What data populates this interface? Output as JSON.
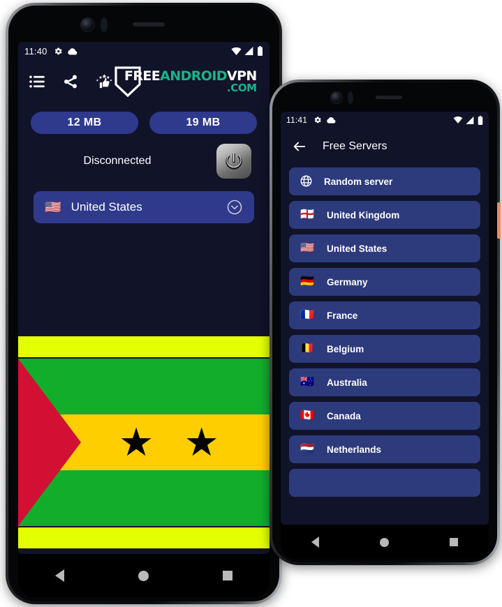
{
  "phone1": {
    "status_bar": {
      "time": "11:40",
      "left_icons": [
        "settings-gear-icon",
        "cloud-icon"
      ],
      "right_icons": [
        "wifi-icon",
        "signal-icon",
        "battery-icon"
      ]
    },
    "toolbar": {
      "icons": [
        "list-menu-icon",
        "share-icon",
        "rate-thumbs-up-icon"
      ],
      "brand": {
        "part1": "FREE",
        "part2": "ANDROID",
        "part3": "VPN",
        "part4": ".COM",
        "color_white": "#ffffff",
        "color_teal": "#18b48a"
      }
    },
    "usage": {
      "download_label": "12 MB",
      "upload_label": "19 MB"
    },
    "connection": {
      "status_text": "Disconnected",
      "power_button_label": "power-toggle"
    },
    "country_selector": {
      "flag": "🇺🇸",
      "name": "United States",
      "chevron": "chevron-down-circle-icon"
    },
    "flag_banner": {
      "name": "Sao Tome and Principe",
      "band_color": "#e4ff00",
      "green": "#12ad2b",
      "yellow": "#ffce00",
      "red": "#d21034",
      "star": "★"
    },
    "nav_bar": [
      "back-nav-button",
      "home-nav-button",
      "recents-nav-button"
    ]
  },
  "phone2": {
    "status_bar": {
      "time": "11:41",
      "left_icons": [
        "settings-gear-icon",
        "cloud-icon"
      ],
      "right_icons": [
        "wifi-icon",
        "signal-icon",
        "battery-icon"
      ]
    },
    "app_bar": {
      "back_icon": "arrow-left-icon",
      "title": "Free Servers"
    },
    "servers": [
      {
        "flag": "globe",
        "label": "Random server"
      },
      {
        "flag": "🏴󠁧󠁢󠁥󠁮󠁧󠁿",
        "label": "United Kingdom"
      },
      {
        "flag": "🇺🇸",
        "label": "United States"
      },
      {
        "flag": "🇩🇪",
        "label": "Germany"
      },
      {
        "flag": "🇫🇷",
        "label": "France"
      },
      {
        "flag": "🇧🇪",
        "label": "Belgium"
      },
      {
        "flag": "🇦🇺",
        "label": "Australia"
      },
      {
        "flag": "🇨🇦",
        "label": "Canada"
      },
      {
        "flag": "🇳🇱",
        "label": "Netherlands"
      }
    ],
    "nav_bar": [
      "back-nav-button",
      "home-nav-button",
      "recents-nav-button"
    ]
  },
  "colors": {
    "app_background": "#111329",
    "pill_blue": "#2f3a8c",
    "list_blue": "#2d3a7c",
    "accent_teal": "#18b48a",
    "side_button_orange": "#f08a63"
  }
}
